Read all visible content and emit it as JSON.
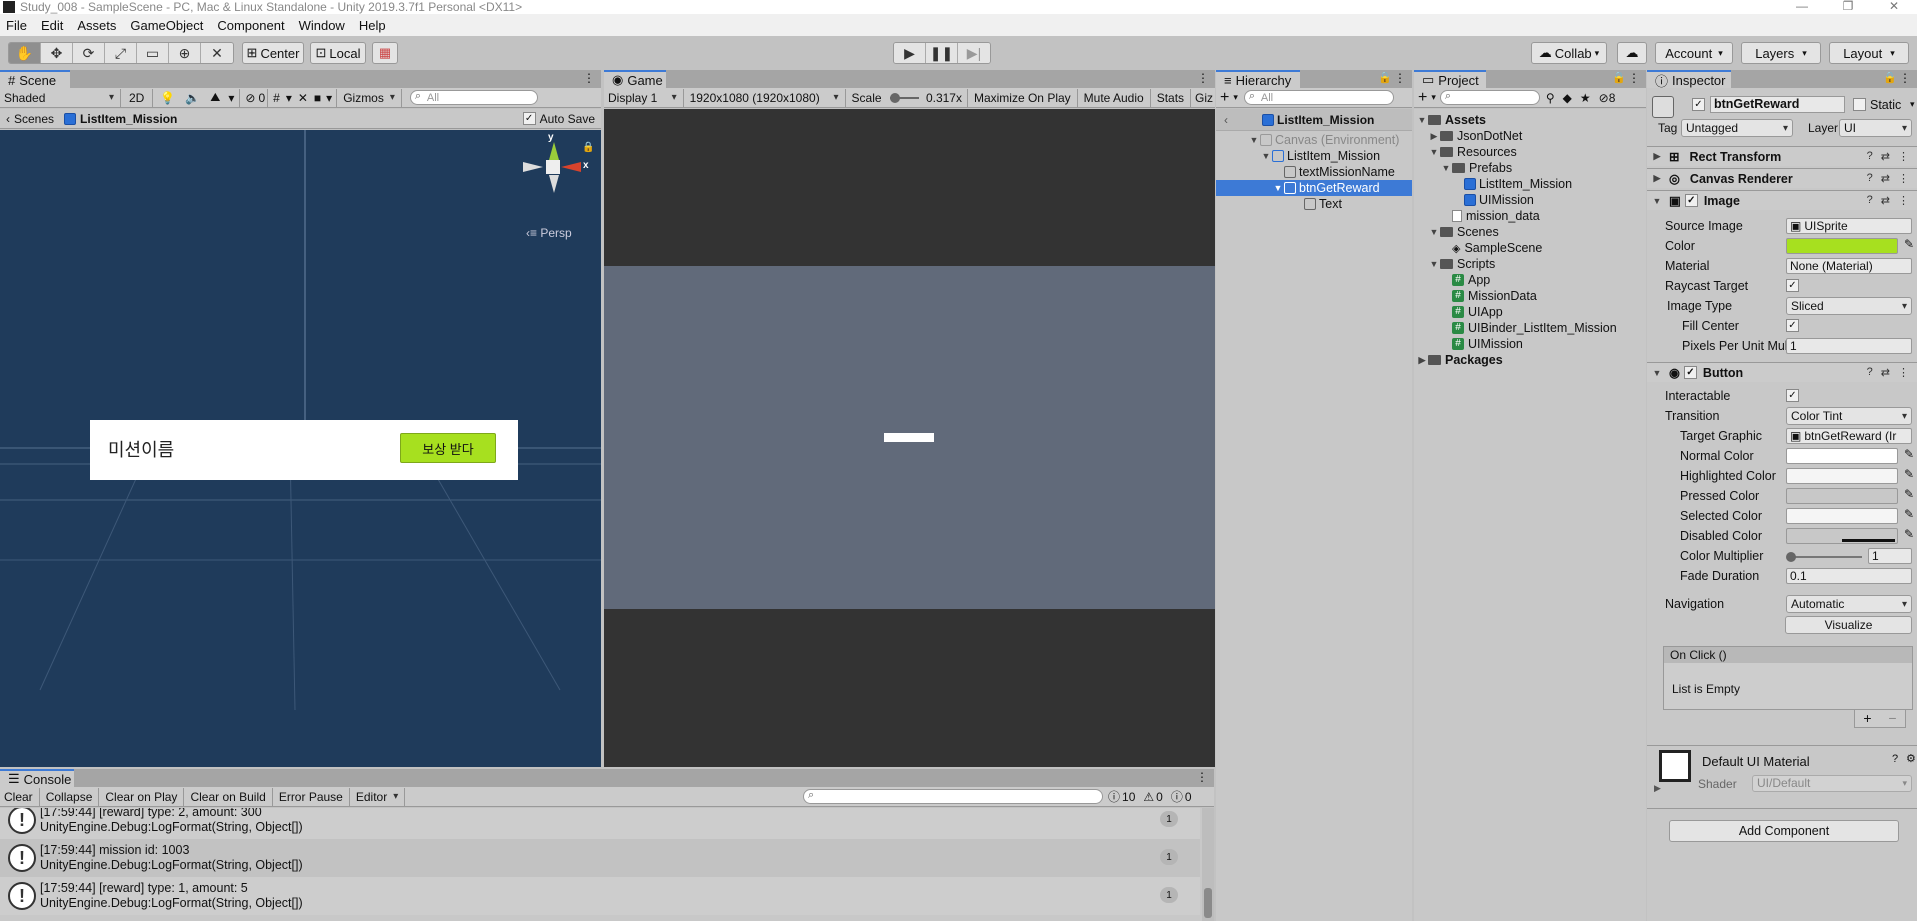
{
  "window": {
    "title": "Study_008 - SampleScene - PC, Mac & Linux Standalone - Unity 2019.3.7f1 Personal <DX11>"
  },
  "menu": [
    "File",
    "Edit",
    "Assets",
    "GameObject",
    "Component",
    "Window",
    "Help"
  ],
  "toolbar": {
    "center": "Center",
    "local": "Local",
    "collab": "Collab",
    "account": "Account",
    "layers": "Layers",
    "layout": "Layout"
  },
  "scene": {
    "tab": "Scene",
    "shading": "Shaded",
    "mode_2d": "2D",
    "hidden_count": "0",
    "gizmos": "Gizmos",
    "search_placeholder": "All",
    "breadcrumb_root": "Scenes",
    "breadcrumb_item": "ListItem_Mission",
    "auto_save": "Auto Save",
    "persp": "Persp",
    "gizmo_y": "y",
    "gizmo_x": "x",
    "mission_name": "미션이름",
    "reward_button": "보상 받다",
    "colors": {
      "sky": "#1f3b5b",
      "button": "#a7e01f"
    }
  },
  "game": {
    "tab": "Game",
    "display": "Display 1",
    "resolution": "1920x1080 (1920x1080)",
    "scale_label": "Scale",
    "scale_value": "0.317x",
    "maximize": "Maximize On Play",
    "mute": "Mute Audio",
    "stats": "Stats",
    "gizmos": "Giz"
  },
  "hierarchy": {
    "tab": "Hierarchy",
    "search_placeholder": "All",
    "root": "ListItem_Mission",
    "items": [
      {
        "label": "Canvas (Environment)",
        "depth": 0,
        "state": "dim"
      },
      {
        "label": "ListItem_Mission",
        "depth": 1,
        "state": "normal"
      },
      {
        "label": "textMissionName",
        "depth": 2,
        "state": "normal"
      },
      {
        "label": "btnGetReward",
        "depth": 2,
        "state": "selected"
      },
      {
        "label": "Text",
        "depth": 3,
        "state": "normal"
      }
    ]
  },
  "project": {
    "tab": "Project",
    "hidden_count": "8",
    "items": [
      {
        "label": "Assets",
        "type": "folder",
        "bold": true
      },
      {
        "label": "JsonDotNet",
        "type": "folder"
      },
      {
        "label": "Resources",
        "type": "folder"
      },
      {
        "label": "Prefabs",
        "type": "folder"
      },
      {
        "label": "ListItem_Mission",
        "type": "prefab"
      },
      {
        "label": "UIMission",
        "type": "prefab"
      },
      {
        "label": "mission_data",
        "type": "file"
      },
      {
        "label": "Scenes",
        "type": "folder"
      },
      {
        "label": "SampleScene",
        "type": "scene"
      },
      {
        "label": "Scripts",
        "type": "folder"
      },
      {
        "label": "App",
        "type": "script"
      },
      {
        "label": "MissionData",
        "type": "script"
      },
      {
        "label": "UIApp",
        "type": "script"
      },
      {
        "label": "UIBinder_ListItem_Mission",
        "type": "script"
      },
      {
        "label": "UIMission",
        "type": "script"
      },
      {
        "label": "Packages",
        "type": "folder",
        "bold": true
      }
    ]
  },
  "inspector": {
    "tab": "Inspector",
    "object_name": "btnGetReward",
    "static": "Static",
    "tag_label": "Tag",
    "tag_value": "Untagged",
    "layer_label": "Layer",
    "layer_value": "UI",
    "rect_transform": "Rect Transform",
    "canvas_renderer": "Canvas Renderer",
    "image": "Image",
    "source_image_label": "Source Image",
    "source_image_value": "UISprite",
    "color_label": "Color",
    "color_value": "#a7e01f",
    "material_label": "Material",
    "material_value": "None (Material)",
    "raycast_label": "Raycast Target",
    "image_type_label": "Image Type",
    "image_type_value": "Sliced",
    "fill_center_label": "Fill Center",
    "ppu_label": "Pixels Per Unit Mul",
    "ppu_value": "1",
    "button": "Button",
    "interactable_label": "Interactable",
    "transition_label": "Transition",
    "transition_value": "Color Tint",
    "target_graphic_label": "Target Graphic",
    "target_graphic_value": "btnGetReward (Ir",
    "normal_color": "Normal Color",
    "highlighted_color": "Highlighted Color",
    "pressed_color": "Pressed Color",
    "selected_color": "Selected Color",
    "disabled_color": "Disabled Color",
    "color_multiplier_label": "Color Multiplier",
    "color_multiplier_value": "1",
    "fade_duration_label": "Fade Duration",
    "fade_duration_value": "0.1",
    "navigation_label": "Navigation",
    "navigation_value": "Automatic",
    "visualize": "Visualize",
    "onclick": "On Click ()",
    "list_empty": "List is Empty",
    "material_name": "Default UI Material",
    "shader_label": "Shader",
    "shader_value": "UI/Default",
    "add_component": "Add Component"
  },
  "console": {
    "tab": "Console",
    "buttons": [
      "Clear",
      "Collapse",
      "Clear on Play",
      "Clear on Build",
      "Error Pause",
      "Editor"
    ],
    "log_count": "10",
    "warn_count": "0",
    "error_count": "0",
    "logs": [
      {
        "line1": "[17:59:44] [reward] type: 2, amount: 300",
        "line2": "UnityEngine.Debug:LogFormat(String, Object[])",
        "count": "1"
      },
      {
        "line1": "[17:59:44] mission id: 1003",
        "line2": "UnityEngine.Debug:LogFormat(String, Object[])",
        "count": "1"
      },
      {
        "line1": "[17:59:44] [reward] type: 1, amount: 5",
        "line2": "UnityEngine.Debug:LogFormat(String, Object[])",
        "count": "1"
      }
    ]
  }
}
